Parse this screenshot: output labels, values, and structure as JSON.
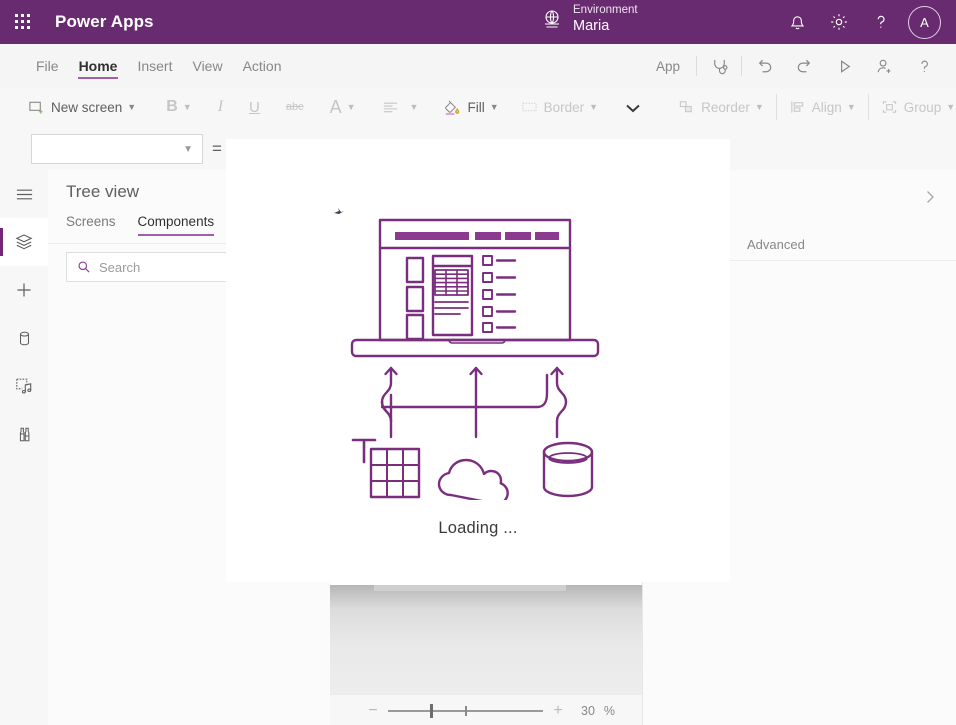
{
  "header": {
    "waffle_icon": "app-launcher-icon",
    "brand": "Power Apps",
    "environment_icon": "environment-globe-icon",
    "environment_label": "Environment",
    "environment_name": "Maria",
    "notifications_icon": "bell-icon",
    "settings_icon": "gear-icon",
    "help_icon": "question-mark-icon",
    "avatar_initial": "A",
    "background_color": "#692B6F"
  },
  "menubar": {
    "items": [
      {
        "label": "File",
        "active": false
      },
      {
        "label": "Home",
        "active": true
      },
      {
        "label": "Insert",
        "active": false
      },
      {
        "label": "View",
        "active": false
      },
      {
        "label": "Action",
        "active": false
      }
    ],
    "app_label": "App",
    "tools": [
      {
        "name": "app-checker-icon"
      },
      {
        "name": "undo-icon"
      },
      {
        "name": "redo-icon"
      },
      {
        "name": "preview-app-icon"
      },
      {
        "name": "share-app-icon"
      },
      {
        "name": "help-icon"
      }
    ],
    "active_accent": "#a05fa8"
  },
  "ribbon": {
    "new_screen": "New screen",
    "bold": "B",
    "italic": "I",
    "underline": "U",
    "strikethrough": "abc",
    "font_size": "A",
    "align": "align-icon",
    "fill": "Fill",
    "border": "Border",
    "more_caret": "chevron-down-icon",
    "reorder": "Reorder",
    "align_group": "Align",
    "group": "Group"
  },
  "formula_bar": {
    "property_value": "",
    "property_caret": "chevron-down-icon",
    "equals": "="
  },
  "rail": {
    "items": [
      {
        "name": "hamburger-menu-icon",
        "active": false
      },
      {
        "name": "tree-view-layers-icon",
        "active": true
      },
      {
        "name": "insert-plus-icon",
        "active": false
      },
      {
        "name": "data-sources-icon",
        "active": false
      },
      {
        "name": "media-icon",
        "active": false
      },
      {
        "name": "variables-icon",
        "active": false
      }
    ],
    "active_accent": "#742774"
  },
  "tree_view": {
    "title": "Tree view",
    "tabs": [
      {
        "label": "Screens",
        "active": false
      },
      {
        "label": "Components",
        "active": true
      }
    ],
    "search_placeholder": "Search",
    "search_value": "",
    "search_icon": "search-icon"
  },
  "properties_panel": {
    "expand_icon": "chevron-right-icon",
    "tabs": [
      {
        "label": "Advanced",
        "active": false
      }
    ]
  },
  "canvas": {
    "zoom": {
      "minus": "−",
      "plus": "+",
      "value": "30",
      "unit": "%"
    }
  },
  "loading_dialog": {
    "illustration": "data-connection-illustration",
    "text": "Loading ...",
    "accent_color": "#7A2E7E"
  }
}
